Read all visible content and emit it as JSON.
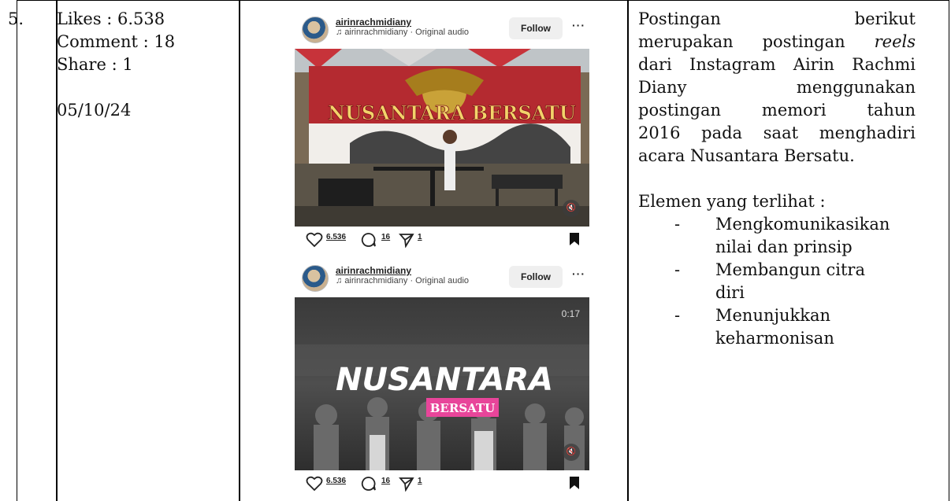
{
  "row": {
    "number": "5.",
    "stats": [
      "Likes : 6.538",
      "Comment : 18",
      "Share : 1"
    ],
    "date": "05/10/24"
  },
  "posts": [
    {
      "username": "airinrachmidiany",
      "audio": "airinrachmidiany · Original audio",
      "follow_label": "Follow",
      "more_label": "···",
      "likes": "6.536",
      "comments": "16",
      "shares": "1",
      "banner_text": "NUSANTARA BERSATU",
      "duration": ""
    },
    {
      "username": "airinrachmidiany",
      "audio": "airinrachmidiany · Original audio",
      "follow_label": "Follow",
      "more_label": "···",
      "likes": "6.536",
      "comments": "16",
      "shares": "1",
      "title_main": "NUSANTARA",
      "title_sub": "BERSATU",
      "duration": "0:17"
    }
  ],
  "description": {
    "lines": [
      "Postingan berikut",
      "merupakan postingan reels",
      "dari Instagram Airin Rachmi",
      "Diany menggunakan",
      "postingan memori tahun",
      "2016 pada saat menghadiri",
      "acara Nusantara Bersatu."
    ],
    "elements_heading": "Elemen yang terlihat :",
    "bullet_marker": "-",
    "elements": [
      [
        "Mengkomunikasikan",
        "nilai dan prinsip"
      ],
      [
        "Membangun citra",
        "diri"
      ],
      [
        "Menunjukkan",
        "keharmonisan"
      ]
    ]
  },
  "colors": {
    "follow_bg": "#efefef",
    "title_pink": "#e8459a",
    "banner_red": "#c0242c"
  }
}
